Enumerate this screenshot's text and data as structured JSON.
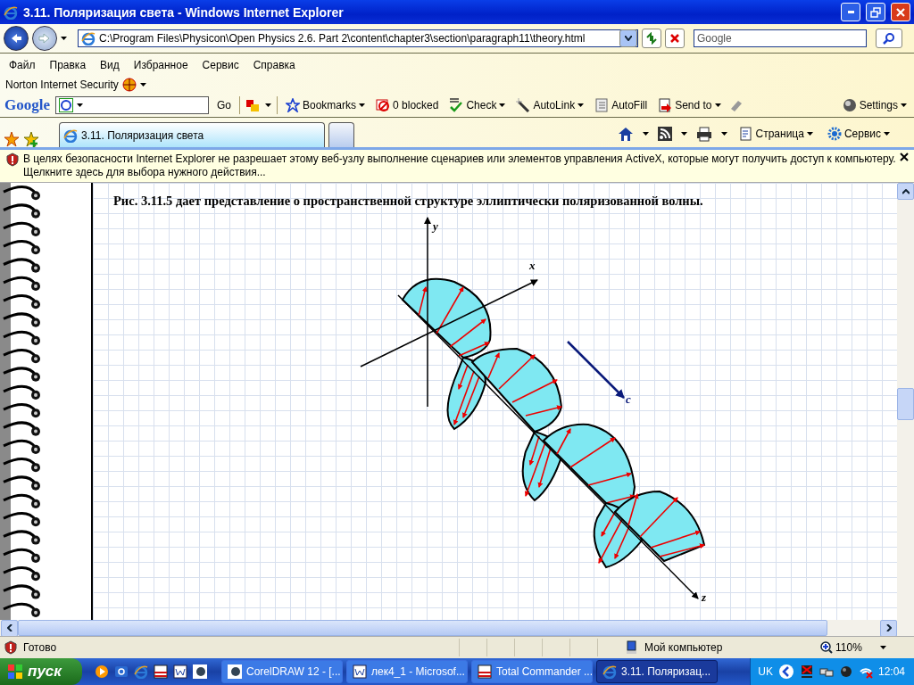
{
  "window": {
    "title": "3.11. Поляризация света - Windows Internet Explorer"
  },
  "address_bar": {
    "value": "C:\\Program Files\\Physicon\\Open Physics 2.6. Part 2\\content\\chapter3\\section\\paragraph11\\theory.html"
  },
  "search": {
    "placeholder": "Google"
  },
  "menu": [
    "Файл",
    "Правка",
    "Вид",
    "Избранное",
    "Сервис",
    "Справка"
  ],
  "norton_bar": {
    "label": "Norton Internet Security"
  },
  "google_toolbar": {
    "logo": "Google",
    "go": "Go",
    "settings": "Settings",
    "items": [
      {
        "kind": "bookmarks",
        "label": "Bookmarks",
        "dropdown": true
      },
      {
        "kind": "blocker",
        "label": "0 blocked",
        "dropdown": false
      },
      {
        "kind": "spellcheck",
        "label": "Check",
        "dropdown": true
      },
      {
        "kind": "autolink",
        "label": "AutoLink",
        "dropdown": true
      },
      {
        "kind": "autofill",
        "label": "AutoFill",
        "dropdown": false
      },
      {
        "kind": "sendto",
        "label": "Send to",
        "dropdown": true
      }
    ]
  },
  "tabs": [
    {
      "label": "3.11. Поляризация света",
      "selected": true
    }
  ],
  "command_bar": {
    "page": "Страница",
    "tools": "Сервис"
  },
  "info_bar": {
    "text": "В целях безопасности Internet Explorer не разрешает этому веб-узлу выполнение сценариев или элементов управления ActiveX, которые могут получить доступ к компьютеру. Щелкните здесь для выбора нужного действия..."
  },
  "content": {
    "caption": "Рис. 3.11.5 дает представление о пространственной структуре эллиптически поляризованной волны."
  },
  "diagram": {
    "y_label": "y",
    "x_label": "x",
    "z_label": "z",
    "velocity_label": "c"
  },
  "status_bar": {
    "text": "Готово",
    "zone": "Мой компьютер",
    "zoom": "110%"
  },
  "taskbar": {
    "start": "пуск",
    "language": "UK",
    "clock": "12:04",
    "tasks": [
      {
        "label": "CorelDRAW 12 - [...",
        "kind": "corel",
        "selected": false
      },
      {
        "label": "лек4_1 - Microsof...",
        "kind": "word",
        "selected": false
      },
      {
        "label": "Total Commander ...",
        "kind": "commander",
        "selected": false
      },
      {
        "label": "3.11. Поляризац...",
        "kind": "browser",
        "selected": true
      }
    ]
  }
}
